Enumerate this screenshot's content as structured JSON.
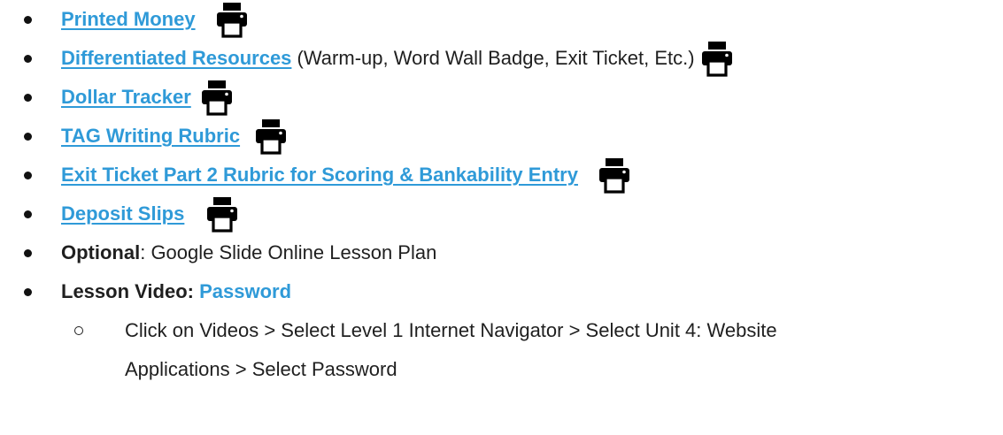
{
  "items": [
    {
      "link": "Printed Money",
      "printer_icon": "printer-icon"
    },
    {
      "link": "Differentiated Resources",
      "suffix": " (Warm-up, Word Wall Badge, Exit Ticket, Etc.) ",
      "printer_icon": "printer-icon"
    },
    {
      "link": "Dollar Tracker",
      "printer_icon": "printer-icon"
    },
    {
      "link": "TAG Writing Rubric",
      "printer_icon": "printer-icon"
    },
    {
      "link": "Exit Ticket Part 2 Rubric for Scoring & Bankability Entry",
      "printer_icon": "printer-icon"
    },
    {
      "link": "Deposit Slips",
      "printer_icon": "printer-icon"
    }
  ],
  "optional": {
    "label": "Optional",
    "text": ": Google Slide Online Lesson Plan"
  },
  "lesson_video": {
    "label": "Lesson Video: ",
    "link": "Password",
    "instructions": "Click on Videos > Select Level 1 Internet Navigator > Select Unit 4: Website Applications > Select Password"
  },
  "colors": {
    "link": "#2f9ad8",
    "text": "#1f1f1f",
    "icon": "#000000"
  }
}
